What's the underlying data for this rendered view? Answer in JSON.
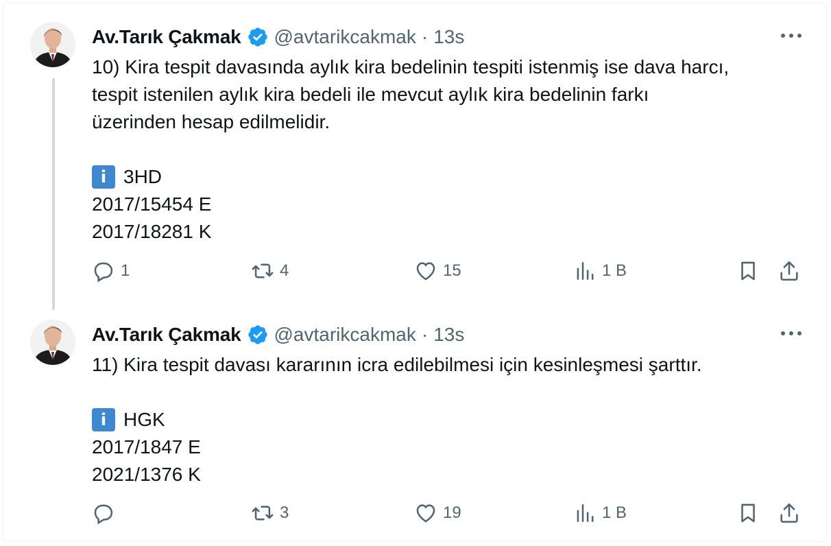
{
  "colors": {
    "verified_badge": "#1d9bf0",
    "info_badge": "#3f88d0",
    "secondary_text": "#536471",
    "thread_line": "#cfd9de"
  },
  "tweets": [
    {
      "author_name": "Av.Tarık Çakmak",
      "handle": "@avtarikcakmak",
      "separator": "·",
      "time": "13s",
      "text_lines": [
        "10) Kira tespit davasında aylık kira bedelinin tespiti istenmiş ise dava harcı,",
        "tespit istenilen aylık kira bedeli ile mevcut aylık kira bedelinin farkı",
        "üzerinden hesap edilmelidir."
      ],
      "info_icon": "i",
      "info_court": "3HD",
      "esas": "2017/15454 E",
      "karar": "2017/18281 K",
      "actions": {
        "replies": "1",
        "retweets": "4",
        "likes": "15",
        "views": "1 B"
      }
    },
    {
      "author_name": "Av.Tarık Çakmak",
      "handle": "@avtarikcakmak",
      "separator": "·",
      "time": "13s",
      "text_lines": [
        "11) Kira tespit davası kararının icra edilebilmesi için kesinleşmesi şarttır."
      ],
      "info_icon": "i",
      "info_court": "HGK",
      "esas": "2017/1847 E",
      "karar": "2021/1376 K",
      "actions": {
        "replies": "",
        "retweets": "3",
        "likes": "19",
        "views": "1 B"
      }
    }
  ]
}
